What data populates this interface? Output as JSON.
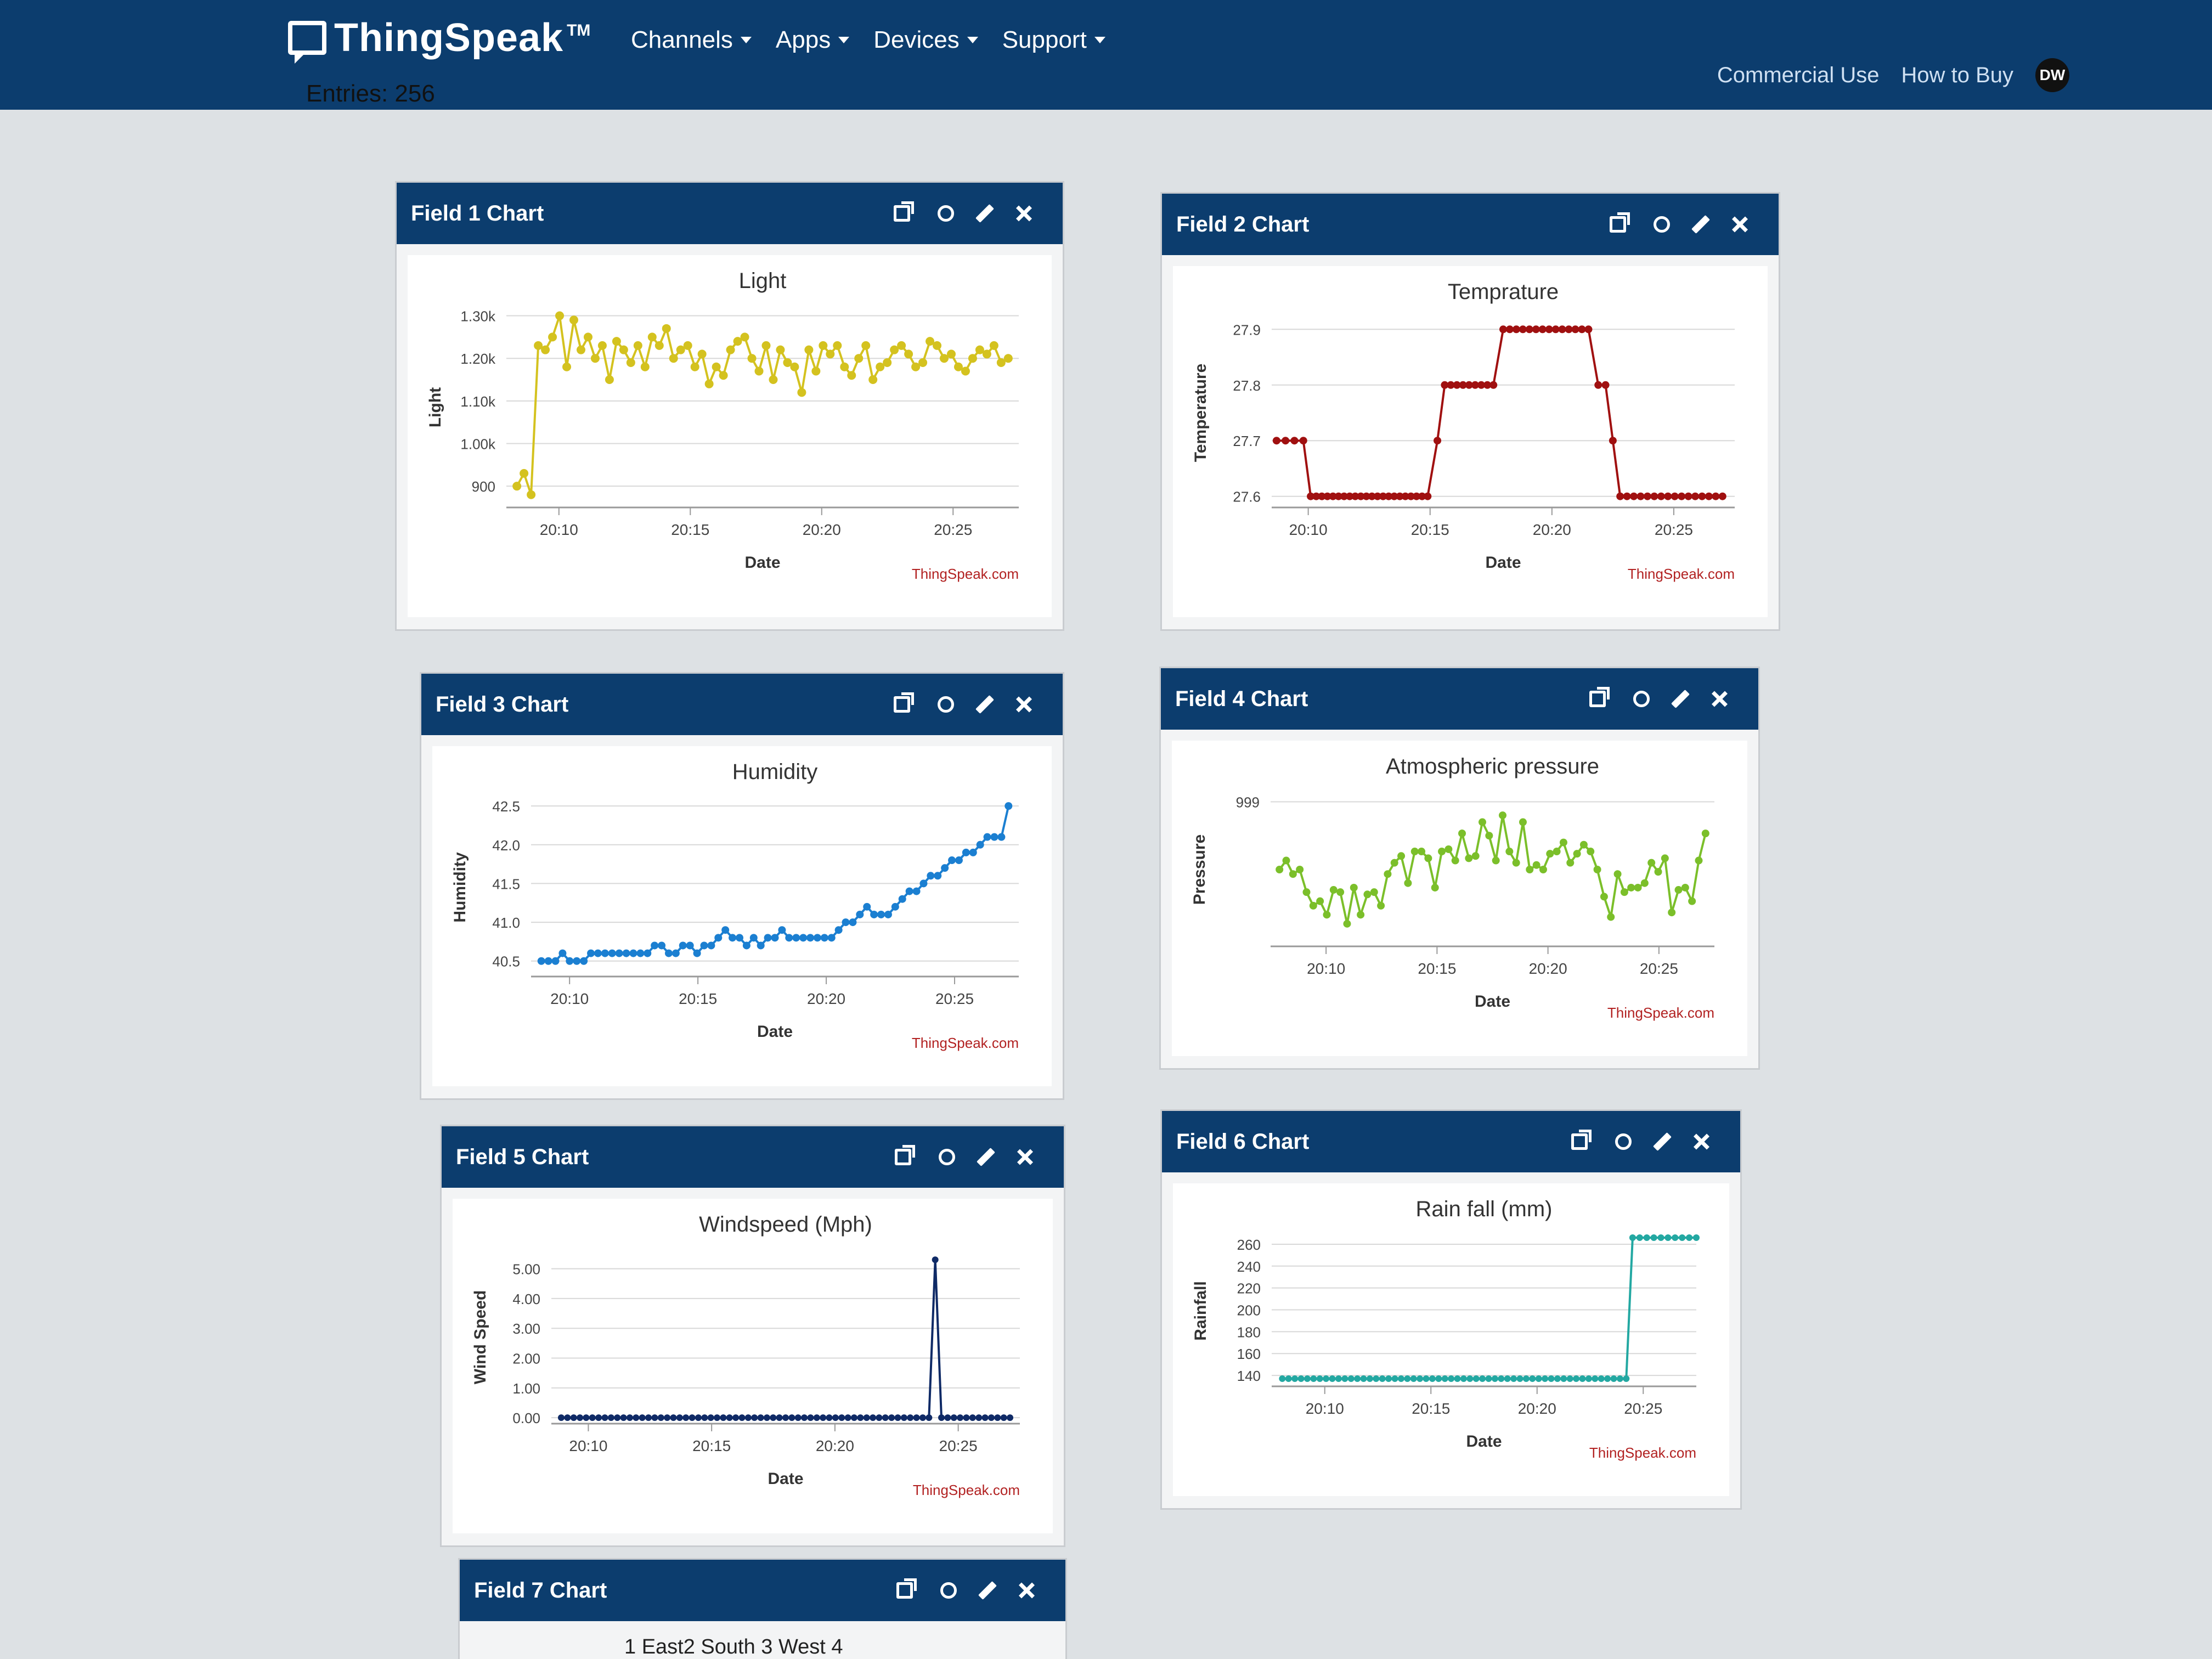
{
  "navbar": {
    "brand": "ThingSpeak",
    "trademark": "TM",
    "menu": [
      "Channels",
      "Apps",
      "Devices",
      "Support"
    ],
    "right_links": [
      "Commercial Use",
      "How to Buy"
    ],
    "avatar_initials": "DW"
  },
  "entries_text": "Entries: 256",
  "icons": [
    "external-link-icon",
    "comment-icon",
    "pencil-icon",
    "close-icon"
  ],
  "colors": {
    "navbar": "#0c3d6e",
    "panel_header": "#0c3d6e",
    "credit": "#b22222"
  },
  "panels": [
    {
      "title": "Field 1 Chart"
    },
    {
      "title": "Field 2 Chart"
    },
    {
      "title": "Field 3 Chart"
    },
    {
      "title": "Field 4 Chart"
    },
    {
      "title": "Field 5 Chart"
    },
    {
      "title": "Field 6 Chart"
    },
    {
      "title": "Field 7 Chart"
    }
  ],
  "chart_data": [
    {
      "type": "line",
      "title": "Light",
      "xlabel": "Date",
      "ylabel": "Light",
      "credit": "ThingSpeak.com",
      "color": "#d4c21f",
      "xticks": [
        "20:10",
        "20:15",
        "20:20",
        "20:25"
      ],
      "xrange": [
        8,
        27.5
      ],
      "x_tick_values": [
        10,
        15,
        20,
        25
      ],
      "yticks": [
        "900",
        "1.00k",
        "1.10k",
        "1.20k",
        "1.30k"
      ],
      "y_tick_values": [
        900,
        1000,
        1100,
        1200,
        1300
      ],
      "ylim": [
        850,
        1320
      ],
      "values": [
        900,
        930,
        880,
        1230,
        1220,
        1250,
        1300,
        1180,
        1290,
        1220,
        1250,
        1200,
        1230,
        1150,
        1240,
        1220,
        1190,
        1230,
        1180,
        1250,
        1230,
        1270,
        1200,
        1220,
        1230,
        1180,
        1210,
        1140,
        1180,
        1160,
        1220,
        1240,
        1250,
        1200,
        1170,
        1230,
        1150,
        1220,
        1190,
        1180,
        1120,
        1220,
        1170,
        1230,
        1210,
        1230,
        1180,
        1160,
        1200,
        1230,
        1150,
        1180,
        1190,
        1220,
        1230,
        1210,
        1180,
        1190,
        1240,
        1230,
        1200,
        1210,
        1180,
        1170,
        1200,
        1220,
        1210,
        1230,
        1190,
        1200
      ],
      "marker_radius": 8
    },
    {
      "type": "line",
      "title": "Temprature",
      "xlabel": "Date",
      "ylabel": "Temperature",
      "credit": "ThingSpeak.com",
      "color": "#a01010",
      "xticks": [
        "20:10",
        "20:15",
        "20:20",
        "20:25"
      ],
      "xrange": [
        8.5,
        27.5
      ],
      "x_tick_values": [
        10,
        15,
        20,
        25
      ],
      "yticks": [
        "27.6",
        "27.7",
        "27.8",
        "27.9"
      ],
      "y_tick_values": [
        27.6,
        27.7,
        27.8,
        27.9
      ],
      "ylim": [
        27.58,
        27.92
      ],
      "segments": [
        {
          "from": 8.7,
          "to": 9.8,
          "value": 27.7,
          "n": 4
        },
        {
          "from": 10.1,
          "to": 14.9,
          "value": 27.6,
          "n": 22
        },
        {
          "from": 15.3,
          "value": 27.7,
          "n": 1
        },
        {
          "from": 15.6,
          "to": 17.6,
          "value": 27.8,
          "n": 9
        },
        {
          "from": 18.0,
          "to": 21.5,
          "value": 27.9,
          "n": 14
        },
        {
          "from": 21.9,
          "to": 22.2,
          "value": 27.8,
          "n": 2
        },
        {
          "from": 22.5,
          "value": 27.7,
          "n": 1
        },
        {
          "from": 22.8,
          "to": 27.0,
          "value": 27.6,
          "n": 16
        }
      ],
      "marker_radius": 7
    },
    {
      "type": "line",
      "title": "Humidity",
      "xlabel": "Date",
      "ylabel": "Humidity",
      "credit": "ThingSpeak.com",
      "color": "#1b7fd1",
      "xticks": [
        "20:10",
        "20:15",
        "20:20",
        "20:25"
      ],
      "xrange": [
        8.5,
        27.5
      ],
      "x_tick_values": [
        10,
        15,
        20,
        25
      ],
      "yticks": [
        "40.5",
        "41.0",
        "41.5",
        "42.0",
        "42.5"
      ],
      "y_tick_values": [
        40.5,
        41.0,
        41.5,
        42.0,
        42.5
      ],
      "ylim": [
        40.3,
        42.6
      ],
      "values": [
        40.5,
        40.5,
        40.5,
        40.6,
        40.5,
        40.5,
        40.5,
        40.6,
        40.6,
        40.6,
        40.6,
        40.6,
        40.6,
        40.6,
        40.6,
        40.6,
        40.7,
        40.7,
        40.6,
        40.6,
        40.7,
        40.7,
        40.6,
        40.7,
        40.7,
        40.8,
        40.9,
        40.8,
        40.8,
        40.7,
        40.8,
        40.7,
        40.8,
        40.8,
        40.9,
        40.8,
        40.8,
        40.8,
        40.8,
        40.8,
        40.8,
        40.8,
        40.9,
        41.0,
        41.0,
        41.1,
        41.2,
        41.1,
        41.1,
        41.1,
        41.2,
        41.3,
        41.4,
        41.4,
        41.5,
        41.6,
        41.6,
        41.7,
        41.8,
        41.8,
        41.9,
        41.9,
        42.0,
        42.1,
        42.1,
        42.1,
        42.5
      ],
      "marker_radius": 7
    },
    {
      "type": "line",
      "title": "Atmospheric pressure",
      "xlabel": "Date",
      "ylabel": "Pressure",
      "credit": "ThingSpeak.com",
      "color": "#7bbf2a",
      "xticks": [
        "20:10",
        "20:15",
        "20:20",
        "20:25"
      ],
      "xrange": [
        7.5,
        27.5
      ],
      "x_tick_values": [
        10,
        15,
        20,
        25
      ],
      "yticks": [
        "999"
      ],
      "y_tick_values": [
        999
      ],
      "ylim": [
        992.6,
        999.4
      ],
      "values": [
        996.0,
        996.4,
        995.8,
        996.0,
        995.0,
        994.4,
        994.6,
        994.0,
        995.1,
        995.0,
        993.6,
        995.2,
        994.0,
        994.9,
        995.0,
        994.4,
        995.8,
        996.3,
        996.6,
        995.4,
        996.8,
        996.8,
        996.5,
        995.2,
        996.8,
        996.9,
        996.4,
        997.6,
        996.5,
        996.6,
        998.1,
        997.5,
        996.4,
        998.4,
        996.8,
        996.3,
        998.1,
        996.0,
        996.2,
        996.0,
        996.7,
        996.8,
        997.2,
        996.3,
        996.7,
        997.1,
        996.8,
        996.0,
        994.8,
        993.9,
        995.8,
        995.0,
        995.2,
        995.2,
        995.4,
        996.3,
        995.9,
        996.5,
        994.1,
        995.1,
        995.2,
        994.6,
        996.4,
        997.6
      ]
    },
    {
      "type": "line",
      "title": "Windspeed (Mph)",
      "xlabel": "Date",
      "ylabel": "Wind Speed",
      "credit": "ThingSpeak.com",
      "color": "#0f2a66",
      "xticks": [
        "20:10",
        "20:15",
        "20:20",
        "20:25"
      ],
      "xrange": [
        8.5,
        27.5
      ],
      "x_tick_values": [
        10,
        15,
        20,
        25
      ],
      "yticks": [
        "0.00",
        "1.00",
        "2.00",
        "3.00",
        "4.00",
        "5.00"
      ],
      "y_tick_values": [
        0,
        1,
        2,
        3,
        4,
        5
      ],
      "ylim": [
        -0.2,
        5.6
      ],
      "values": [
        0,
        0,
        0,
        0,
        0,
        0,
        0,
        0,
        0,
        0,
        0,
        0,
        0,
        0,
        0,
        0,
        0,
        0,
        0,
        0,
        0,
        0,
        0,
        0,
        0,
        0,
        0,
        0,
        0,
        0,
        0,
        0,
        0,
        0,
        0,
        0,
        0,
        0,
        0,
        0,
        0,
        0,
        0,
        0,
        0,
        0,
        0,
        0,
        0,
        0,
        0,
        0,
        0,
        0,
        0,
        0,
        0,
        0,
        0,
        0,
        5.3,
        0,
        0,
        0,
        0,
        0,
        0,
        0,
        0,
        0,
        0,
        0,
        0
      ],
      "marker_radius": 6
    },
    {
      "type": "line",
      "title": "Rain fall (mm)",
      "xlabel": "Date",
      "ylabel": "Rainfall",
      "credit": "ThingSpeak.com",
      "color": "#23a8a2",
      "xticks": [
        "20:10",
        "20:15",
        "20:20",
        "20:25"
      ],
      "xrange": [
        7.5,
        27.5
      ],
      "x_tick_values": [
        10,
        15,
        20,
        25
      ],
      "yticks": [
        "140",
        "160",
        "180",
        "200",
        "220",
        "240",
        "260"
      ],
      "y_tick_values": [
        140,
        160,
        180,
        200,
        220,
        240,
        260
      ],
      "ylim": [
        130,
        268
      ],
      "segments": [
        {
          "from": 8.0,
          "to": 24.2,
          "value": 137,
          "n": 56
        },
        {
          "from": 24.5,
          "to": 27.5,
          "value": 266,
          "n": 10
        }
      ],
      "marker_radius": 6
    },
    {
      "type": "text",
      "partial_text": "1 East2 South 3 West 4"
    }
  ]
}
